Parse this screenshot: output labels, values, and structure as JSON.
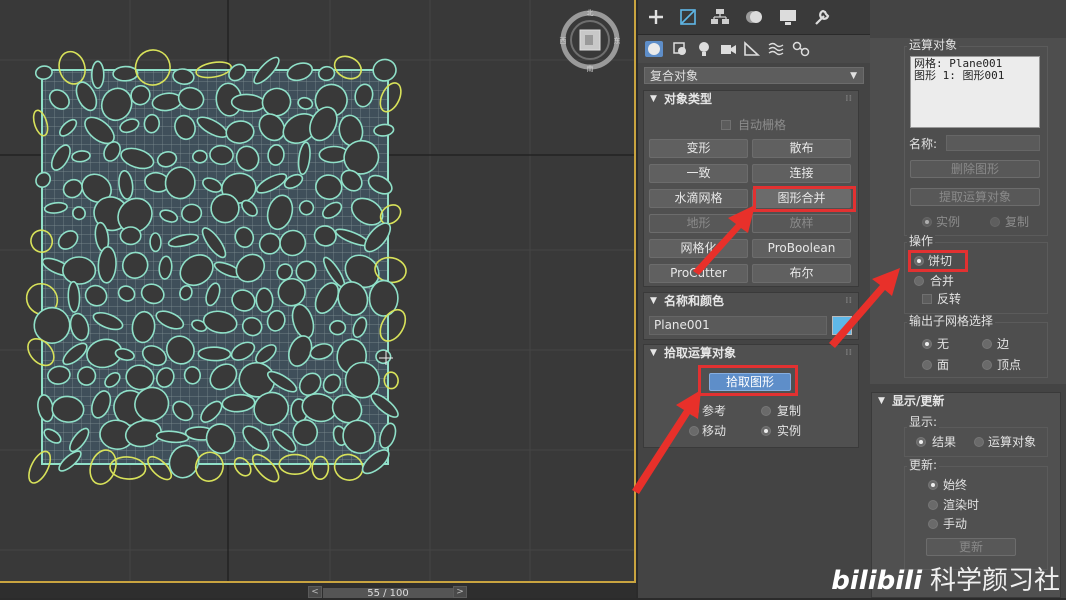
{
  "viewport": {
    "viewcube_labels": {
      "north": "北",
      "west": "西",
      "east": "东",
      "south": "南"
    }
  },
  "timeline": {
    "frame_label": "55 / 100",
    "prev": "<",
    "next": ">"
  },
  "command_panel": {
    "tab_icons": [
      "create-plus-icon",
      "modify-icon",
      "hierarchy-icon",
      "motion-icon",
      "display-icon",
      "utilities-wrench-icon"
    ],
    "category_icons": [
      "geometry-sphere-icon",
      "shapes-icon",
      "lights-icon",
      "cameras-icon",
      "helpers-icon",
      "space-warps-icon",
      "systems-icon"
    ],
    "object_category": "复合对象",
    "object_type": {
      "title": "对象类型",
      "autogrid_label": "自动栅格",
      "buttons": [
        "变形",
        "散布",
        "一致",
        "连接",
        "水滴网格",
        "图形合并",
        "地形",
        "放样",
        "网格化",
        "ProBoolean",
        "ProCutter",
        "布尔"
      ]
    },
    "name_color": {
      "title": "名称和颜色",
      "name_value": "Plane001",
      "swatch_color": "#5fb8e8"
    },
    "pick_operand": {
      "title": "拾取运算对象",
      "pick_button": "拾取图形",
      "options": [
        "参考",
        "复制",
        "移动",
        "实例"
      ]
    }
  },
  "operands_panel": {
    "title": "运算对象",
    "list": [
      "网格: Plane001",
      "图形 1: 图形001"
    ],
    "name_label": "名称:",
    "delete_shape": "删除图形",
    "extract_operand": "提取运算对象",
    "instance_label": "实例",
    "copy_label": "复制"
  },
  "operation": {
    "title": "操作",
    "cookie_cutter": "饼切",
    "merge": "合并",
    "invert": "反转"
  },
  "output_submesh": {
    "title": "输出子网格选择",
    "options": [
      "无",
      "边",
      "面",
      "顶点"
    ]
  },
  "display_update": {
    "title": "显示/更新",
    "display_label": "显示:",
    "result": "结果",
    "operands": "运算对象",
    "update_label": "更新:",
    "always": "始终",
    "when_rendering": "渲染时",
    "manually": "手动",
    "update_button": "更新"
  },
  "watermark": {
    "logo": "bilibili",
    "text": "科学颜习社"
  },
  "colors": {
    "highlight": "#e23131",
    "viewport_border": "#c9a440",
    "mesh_color": "#8fe0c8",
    "shape_outline": "#d8e25a",
    "selected_button": "#5e8ec9"
  }
}
